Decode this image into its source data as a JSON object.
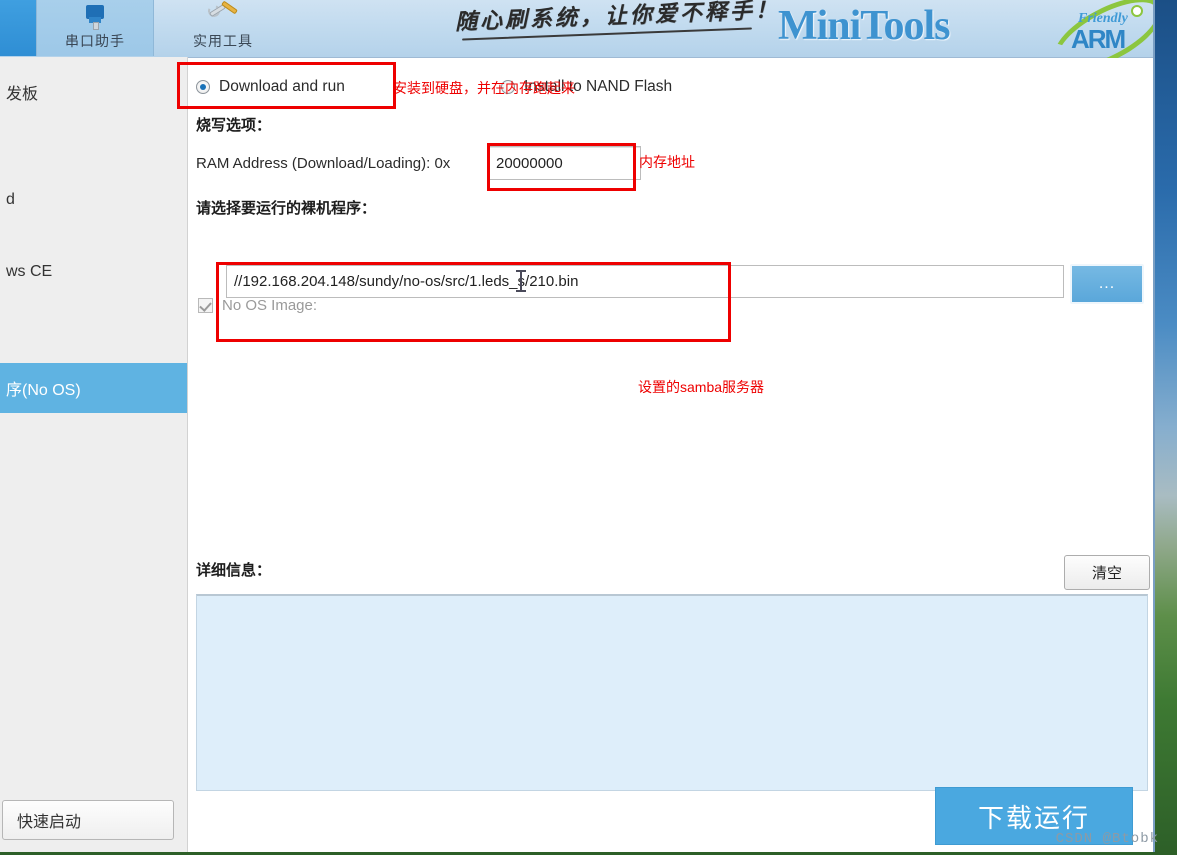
{
  "header": {
    "tabs": [
      {
        "label": "",
        "icon": "active-tab-blank",
        "state": "active"
      },
      {
        "label": "串口助手",
        "icon": "serial-plug-icon",
        "state": "hover"
      },
      {
        "label": "实用工具",
        "icon": "wrench-screwdriver-icon",
        "state": "normal"
      }
    ],
    "slogan": "随心刷系统，让你爱不释手！",
    "brand": "MiniTools",
    "logo": {
      "friendly": "Friendly",
      "arm": "ARM"
    }
  },
  "sidebar": {
    "items": [
      {
        "label": "发板",
        "selected": false
      },
      {
        "label": "d",
        "selected": false
      },
      {
        "label": "ws CE",
        "selected": false
      },
      {
        "label": "序(No OS)",
        "selected": true
      }
    ],
    "quick_start_label": "快速启动"
  },
  "main": {
    "mode_options": [
      {
        "label": "Download and run",
        "selected": true
      },
      {
        "label": "Install to NAND Flash",
        "selected": false
      }
    ],
    "burn_options_title": "烧写选项：",
    "ram_address_label": "RAM Address (Download/Loading): 0x",
    "ram_address_value": "20000000",
    "select_program_title": "请选择要运行的裸机程序：",
    "no_os_image_label": "No OS Image:",
    "no_os_image_checked": true,
    "image_path": "//192.168.204.148/sundy/no-os/src/1.leds_s/210.bin",
    "browse_label": "...",
    "details_title": "详细信息：",
    "clear_label": "清空",
    "log_text": "",
    "run_label": "下载运行"
  },
  "annotations": [
    {
      "id": "ann-install-nand",
      "text": "安装到硬盘，并在内存跑起来"
    },
    {
      "id": "ann-ram-addr",
      "text": "内存地址"
    },
    {
      "id": "ann-samba",
      "text": "设置的samba服务器"
    }
  ],
  "watermark": "CSDN @Btobk",
  "colors": {
    "accent": "#4aa8e0",
    "sidebar_selected": "#5fb3e2",
    "annotation_red": "#ee0000",
    "log_background": "#deeefa",
    "brand_blue": "#3e93d0"
  }
}
